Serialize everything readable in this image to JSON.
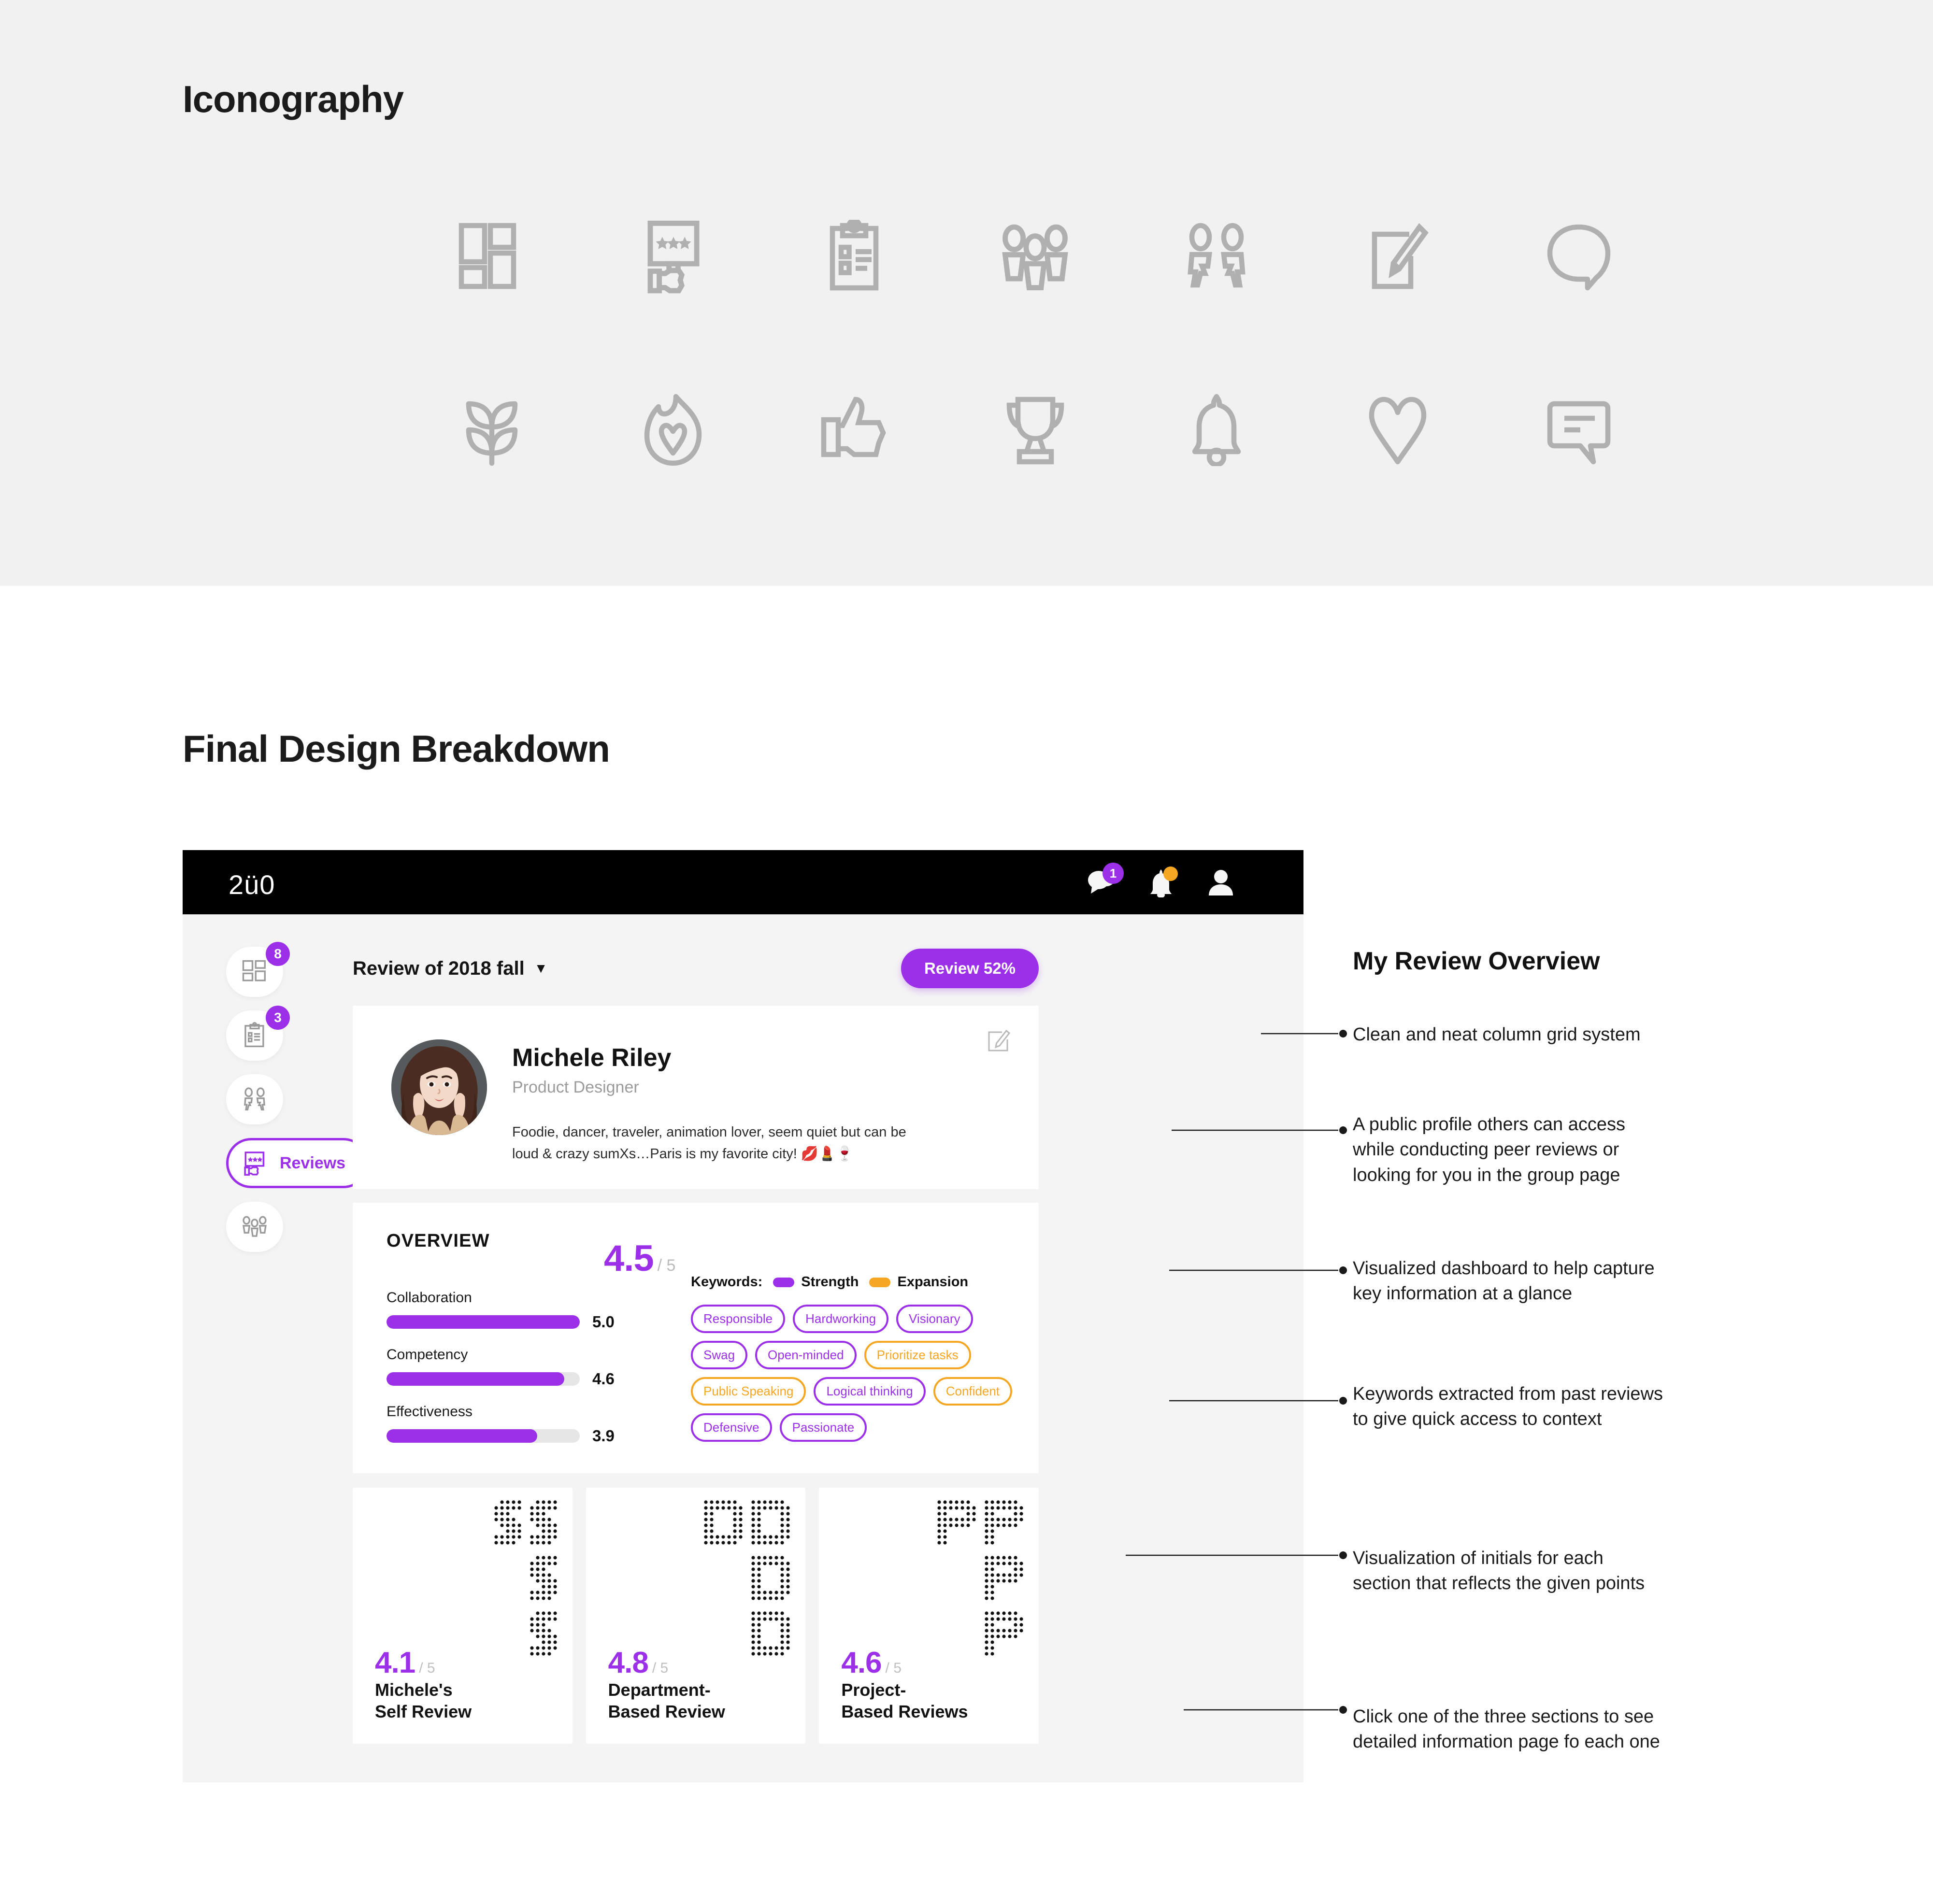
{
  "sections": {
    "iconography_title": "Iconography",
    "breakdown_title": "Final Design Breakdown"
  },
  "iconography": {
    "row1": [
      {
        "name": "dashboard-grid-icon",
        "label": "Dashboard"
      },
      {
        "name": "review-screen-star-icon",
        "label": "Reviews"
      },
      {
        "name": "clipboard-checklist-icon",
        "label": "Tasks"
      },
      {
        "name": "people-group-icon",
        "label": "Group"
      },
      {
        "name": "two-people-peer-icon",
        "label": "Peers"
      },
      {
        "name": "edit-pencil-note-icon",
        "label": "Write"
      },
      {
        "name": "speech-bubble-icon",
        "label": "Comment"
      }
    ],
    "row2": [
      {
        "name": "growth-plant-icon",
        "label": "Growth"
      },
      {
        "name": "flame-heart-icon",
        "label": "Passion"
      },
      {
        "name": "thumbs-up-icon",
        "label": "Like"
      },
      {
        "name": "trophy-icon",
        "label": "Award"
      },
      {
        "name": "bell-icon",
        "label": "Notification"
      },
      {
        "name": "heart-icon",
        "label": "Favorite"
      },
      {
        "name": "chat-message-icon",
        "label": "Message"
      }
    ]
  },
  "app": {
    "brand": "2ü0",
    "header": {
      "chat_badge": "1",
      "bell_has_dot": true
    },
    "rail": [
      {
        "icon": "dashboard-grid-icon",
        "badge": "8",
        "label": "",
        "active": false
      },
      {
        "icon": "clipboard-checklist-icon",
        "badge": "3",
        "label": "",
        "active": false
      },
      {
        "icon": "two-people-peer-icon",
        "badge": "",
        "label": "",
        "active": false
      },
      {
        "icon": "review-screen-star-icon",
        "badge": "",
        "label": "Reviews",
        "active": true
      },
      {
        "icon": "people-group-icon",
        "badge": "",
        "label": "",
        "active": false
      }
    ],
    "review_bar": {
      "selector_label": "Review of 2018 fall",
      "caret": "▼",
      "progress_button": "Review 52%"
    },
    "profile": {
      "name": "Michele Riley",
      "role": "Product Designer",
      "bio": "Foodie, dancer, traveler, animation lover, seem quiet but can be\nloud & crazy sumXs…Paris is my favorite city! 💋💄🍷",
      "edit_icon": "edit-pencil-icon"
    },
    "overview": {
      "heading": "OVERVIEW",
      "score": "4.5",
      "score_max": "/ 5",
      "metrics": [
        {
          "name": "Collaboration",
          "value": "5.0",
          "pct": 100
        },
        {
          "name": "Competency",
          "value": "4.6",
          "pct": 92
        },
        {
          "name": "Effectiveness",
          "value": "3.9",
          "pct": 78
        }
      ],
      "keywords_label": "Keywords:",
      "legend": [
        {
          "label": "Strength",
          "color": "#9b30e8"
        },
        {
          "label": "Expansion",
          "color": "#f5a623"
        }
      ],
      "chips": [
        {
          "label": "Responsible",
          "type": "strength"
        },
        {
          "label": "Hardworking",
          "type": "strength"
        },
        {
          "label": "Visionary",
          "type": "strength"
        },
        {
          "label": "Swag",
          "type": "strength"
        },
        {
          "label": "Open-minded",
          "type": "strength"
        },
        {
          "label": "Prioritize tasks",
          "type": "expansion"
        },
        {
          "label": "Public Speaking",
          "type": "expansion"
        },
        {
          "label": "Logical thinking",
          "type": "strength"
        },
        {
          "label": "Confident",
          "type": "expansion"
        },
        {
          "label": "Defensive",
          "type": "strength"
        },
        {
          "label": "Passionate",
          "type": "strength"
        }
      ]
    },
    "section_cards": [
      {
        "score": "4.1",
        "score_max": "/ 5",
        "label": "Michele's\nSelf Review",
        "initial": "S"
      },
      {
        "score": "4.8",
        "score_max": "/ 5",
        "label": "Department-\nBased Review",
        "initial": "D"
      },
      {
        "score": "4.6",
        "score_max": "/ 5",
        "label": "Project-\nBased Reviews",
        "initial": "P"
      }
    ]
  },
  "annotations": {
    "title": "My Review Overview",
    "items": [
      "Clean and neat column grid system",
      "A public profile others can access\nwhile conducting peer reviews or\nlooking for you in the group page",
      "Visualized dashboard to help capture\nkey information at a glance",
      "Keywords extracted from past reviews\nto give quick access to context",
      "Visualization of initials for each\nsection that reflects the given points",
      "Click one of the three sections to see\ndetailed information page fo each one"
    ]
  },
  "colors": {
    "accent": "#9b30e8",
    "expansion": "#f5a623",
    "band_bg": "#f1f1f1",
    "app_bg": "#f4f4f4",
    "header_bg": "#000000",
    "icon_gray": "#b0b0b0"
  }
}
